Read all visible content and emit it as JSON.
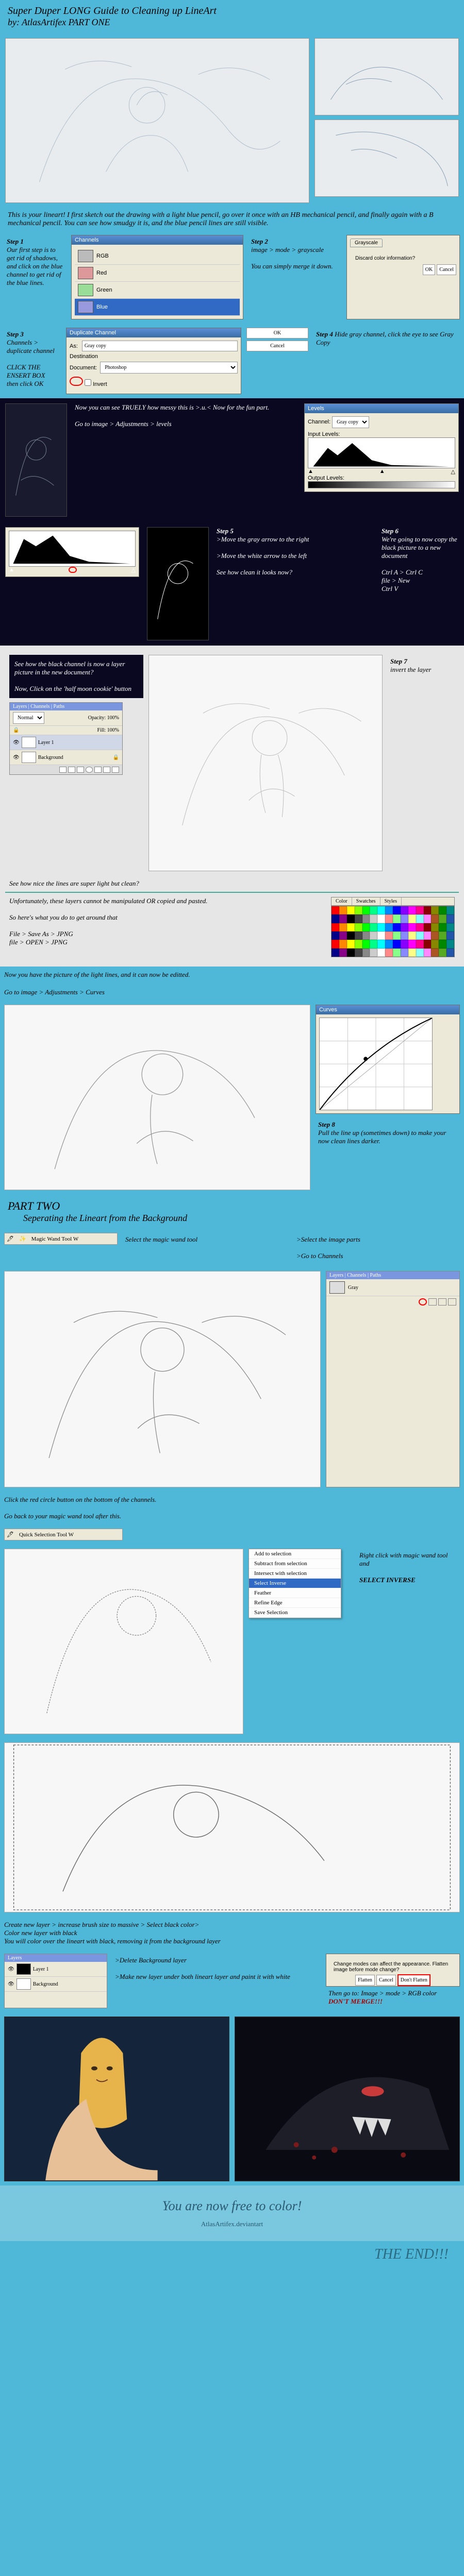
{
  "title": "Super Duper LONG Guide to Cleaning up LineArt",
  "byline": "by: AtlasArtifex          PART ONE",
  "intro": "This is your lineart! I first sketch out the drawing with a light blue pencil, go over it once with an HB mechanical pencil, and finally again with a B mechanical pencil. You can see how smudgy it is, and the blue pencil lines are still visible.",
  "step1": {
    "label": "Step 1",
    "t1": "Our first step is to get rid of shadows, and click on the blue channel to get rid of the blue lines."
  },
  "step2": {
    "label": "Step 2",
    "t1": "image > mode > grayscale",
    "t2": "You can simply merge it down."
  },
  "step3": {
    "label": "Step 3",
    "t1": "Channels > duplicate channel",
    "hint": "CLICK THE ENSERT BOX",
    "t2": "then click OK"
  },
  "step4": {
    "label": "Step 4",
    "t": "Hide gray channel, click the eye to see Gray Copy"
  },
  "blackTxt": "Now you can see TRUELY how messy this is >.u.< Now for the fun part.",
  "blackTxt2": "Go to image > Adjustments > levels",
  "step5": {
    "label": "Step 5",
    "a": ">Move the gray arrow to the right",
    "b": ">Move the white arrow to the left",
    "c": "See how clean it looks now?"
  },
  "step6": {
    "label": "Step 6",
    "t": "We're going to now copy the black picture to a new document",
    "cmds": "Ctrl A > Ctrl C\nfile > New\nCtrl V"
  },
  "step7": {
    "label": "Step 7",
    "t": "invert the layer",
    "blk": "See how the black channel is now a layer picture in the new document?",
    "half": "Now, Click on the 'half moon cookie' button"
  },
  "unfort": "Unfortunately, these layers cannot be manipulated OR copied and pasted.\n\nSo here's what you do to get around that\n\nFile > Save As > JPNG\nfile > OPEN > JPNG",
  "postjpg": "Now you have the picture of the light lines, and it can now be editted.",
  "gotoCurves": "Go to image > Adjustments > Curves",
  "step8": {
    "label": "Step 8",
    "t": "Pull the line up (sometimes down) to make your now clean lines darker."
  },
  "part2label": "PART TWO",
  "part2sub": "Seperating the Lineart from the Background",
  "toolMW": "Magic Wand Tool   W",
  "sel": {
    "a": "Select the magic wand tool",
    "b": ">Select the image parts",
    "c": ">Go to Channels"
  },
  "seeNice": "See how nice the lines are super light but clean?",
  "clickRed": "Click the red circle button on the bottom of the channels.",
  "goBack": "Go back to your magic wand tool after this.",
  "qs": "Quick Selection Tool  W",
  "ctx": {
    "a": "Add to selection",
    "b": "Subtract from selection",
    "c": "Intersect with selection",
    "d": "Select Inverse",
    "e": "Feather",
    "f": "Refine Edge",
    "g": "Save Selection"
  },
  "rightClick": "Right click with magic wand tool and",
  "selectInv": "SELECT INVERSE",
  "createLayer": "Create new layer > increase brush size to massive > Select black color>\nColor new layer with black\nYou will color over the lineart with black, removing it from the background layer",
  "delBg": ">Delete Background layer",
  "mkUnder": ">Make new layer under both lineart layer and paint it with white",
  "thenMode": "Then go to: Image > mode > RGB color",
  "dontMerge": "DON'T MERGE!!!",
  "finalA": "You are now free to color!",
  "sig": "AtlasArtifex.deviantart",
  "end": "THE END!!!",
  "dlgDup": {
    "title": "Duplicate Channel",
    "as": "As:",
    "name": "Gray copy",
    "dest": "Destination",
    "doc": "Document:",
    "invert": "Invert",
    "ok": "OK",
    "cancel": "Cancel"
  },
  "dlgLvl": {
    "title": "Levels",
    "ch": "Channel:",
    "inp": "Input Levels:",
    "out": "Output Levels:"
  },
  "chNames": {
    "rgb": "RGB",
    "r": "Red",
    "g": "Green",
    "b": "Blue",
    "gray": "Gray",
    "gcopy": "Gray copy"
  },
  "lp": {
    "tab1": "Layers",
    "tab2": "Channels",
    "tab3": "Paths",
    "mode": "Normal",
    "op": "Opacity: 100%",
    "fill": "Fill: 100%",
    "bg": "Background",
    "l1": "Layer 1"
  },
  "sw": {
    "t1": "Color",
    "t2": "Swatches",
    "t3": "Styles"
  }
}
